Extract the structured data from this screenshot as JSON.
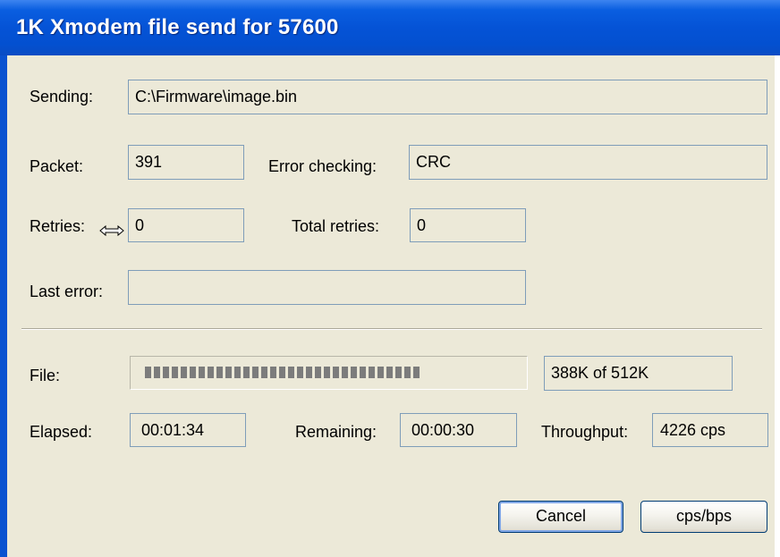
{
  "window": {
    "title": "1K Xmodem file send for 57600"
  },
  "fields": {
    "sending": {
      "label": "Sending:",
      "value": "C:\\Firmware\\image.bin"
    },
    "packet": {
      "label": "Packet:",
      "value": "391"
    },
    "error_checking": {
      "label": "Error checking:",
      "value": "CRC"
    },
    "retries": {
      "label": "Retries:",
      "value": "0"
    },
    "total_retries": {
      "label": "Total retries:",
      "value": "0"
    },
    "last_error": {
      "label": "Last error:",
      "value": ""
    }
  },
  "transfer": {
    "file_label": "File:",
    "progress_fraction": 0.758,
    "progress_text": "388K of 512K",
    "elapsed": {
      "label": "Elapsed:",
      "value": "00:01:34"
    },
    "remaining": {
      "label": "Remaining:",
      "value": "00:00:30"
    },
    "throughput": {
      "label": "Throughput:",
      "value": "4226 cps"
    }
  },
  "buttons": {
    "cancel": "Cancel",
    "cps_bps": "cps/bps"
  },
  "icons": {
    "cursor": "resize-horizontal-cursor-icon"
  },
  "colors": {
    "title_bar": "#0553d6",
    "dialog_bg": "#ece9d8",
    "field_border": "#7f9db9",
    "progress_segment": "#7c7c7c"
  }
}
